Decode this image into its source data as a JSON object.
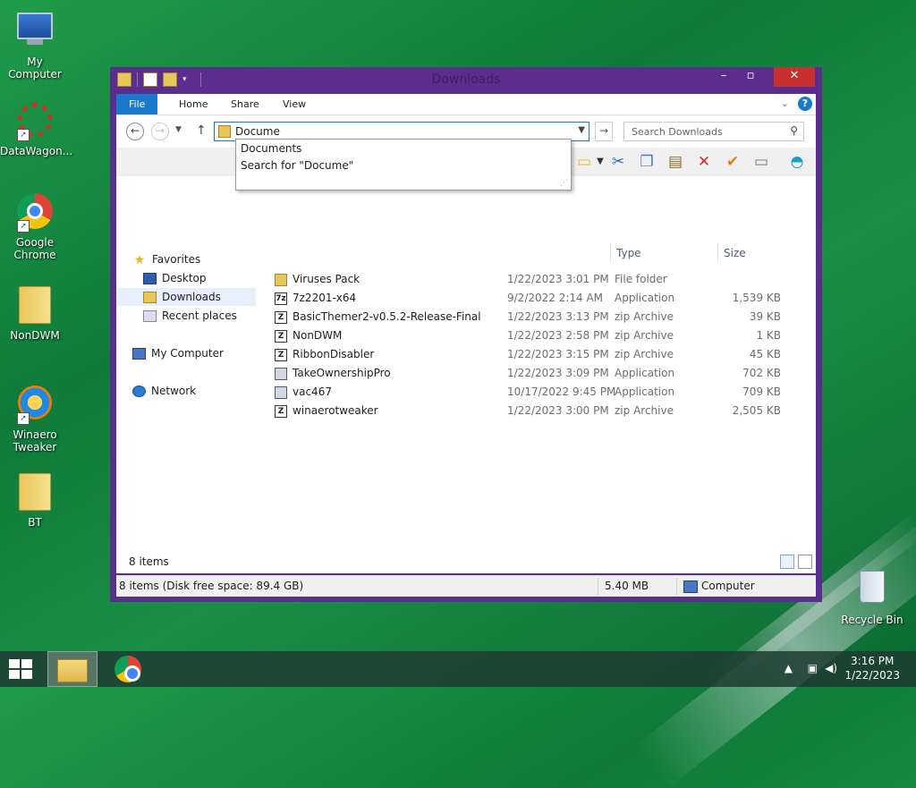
{
  "desktop": {
    "icons": [
      {
        "label": "My Computer"
      },
      {
        "label": "DataWagon..."
      },
      {
        "label": "Google Chrome"
      },
      {
        "label": "NonDWM"
      },
      {
        "label": "Winaero Tweaker"
      },
      {
        "label": "BT"
      },
      {
        "label": "Recycle Bin"
      }
    ]
  },
  "window": {
    "title": "Downloads",
    "tabs": [
      "File",
      "Home",
      "Share",
      "View"
    ],
    "help_label": "?",
    "address": {
      "value": "Docume"
    },
    "search": {
      "placeholder": "Search Downloads"
    },
    "autocomplete": [
      "Documents",
      "Search for \"Docume\""
    ],
    "nav": {
      "favorites": "Favorites",
      "items": [
        "Desktop",
        "Downloads",
        "Recent places"
      ],
      "computer": "My Computer",
      "network": "Network"
    },
    "columns": {
      "type": "Type",
      "size": "Size"
    },
    "files": [
      {
        "name": "Viruses Pack",
        "date": "1/22/2023 3:01 PM",
        "type": "File folder",
        "size": "",
        "icon": "folder"
      },
      {
        "name": "7z2201-x64",
        "date": "9/2/2022 2:14 AM",
        "type": "Application",
        "size": "1,539 KB",
        "icon": "7z"
      },
      {
        "name": "BasicThemer2-v0.5.2-Release-Final",
        "date": "1/22/2023 3:13 PM",
        "type": "zip Archive",
        "size": "39 KB",
        "icon": "zip"
      },
      {
        "name": "NonDWM",
        "date": "1/22/2023 2:58 PM",
        "type": "zip Archive",
        "size": "1 KB",
        "icon": "zip"
      },
      {
        "name": "RibbonDisabler",
        "date": "1/22/2023 3:15 PM",
        "type": "zip Archive",
        "size": "45 KB",
        "icon": "zip"
      },
      {
        "name": "TakeOwnershipPro",
        "date": "1/22/2023 3:09 PM",
        "type": "Application",
        "size": "702 KB",
        "icon": "app"
      },
      {
        "name": "vac467",
        "date": "10/17/2022 9:45 PM",
        "type": "Application",
        "size": "709 KB",
        "icon": "app"
      },
      {
        "name": "winaerotweaker",
        "date": "1/22/2023 3:00 PM",
        "type": "zip Archive",
        "size": "2,505 KB",
        "icon": "zip"
      }
    ],
    "item_count": "8 items",
    "status": {
      "left": "8 items (Disk free space: 89.4 GB)",
      "size": "5.40 MB",
      "location": "Computer"
    }
  },
  "taskbar": {
    "time": "3:16 PM",
    "date": "1/22/2023"
  }
}
